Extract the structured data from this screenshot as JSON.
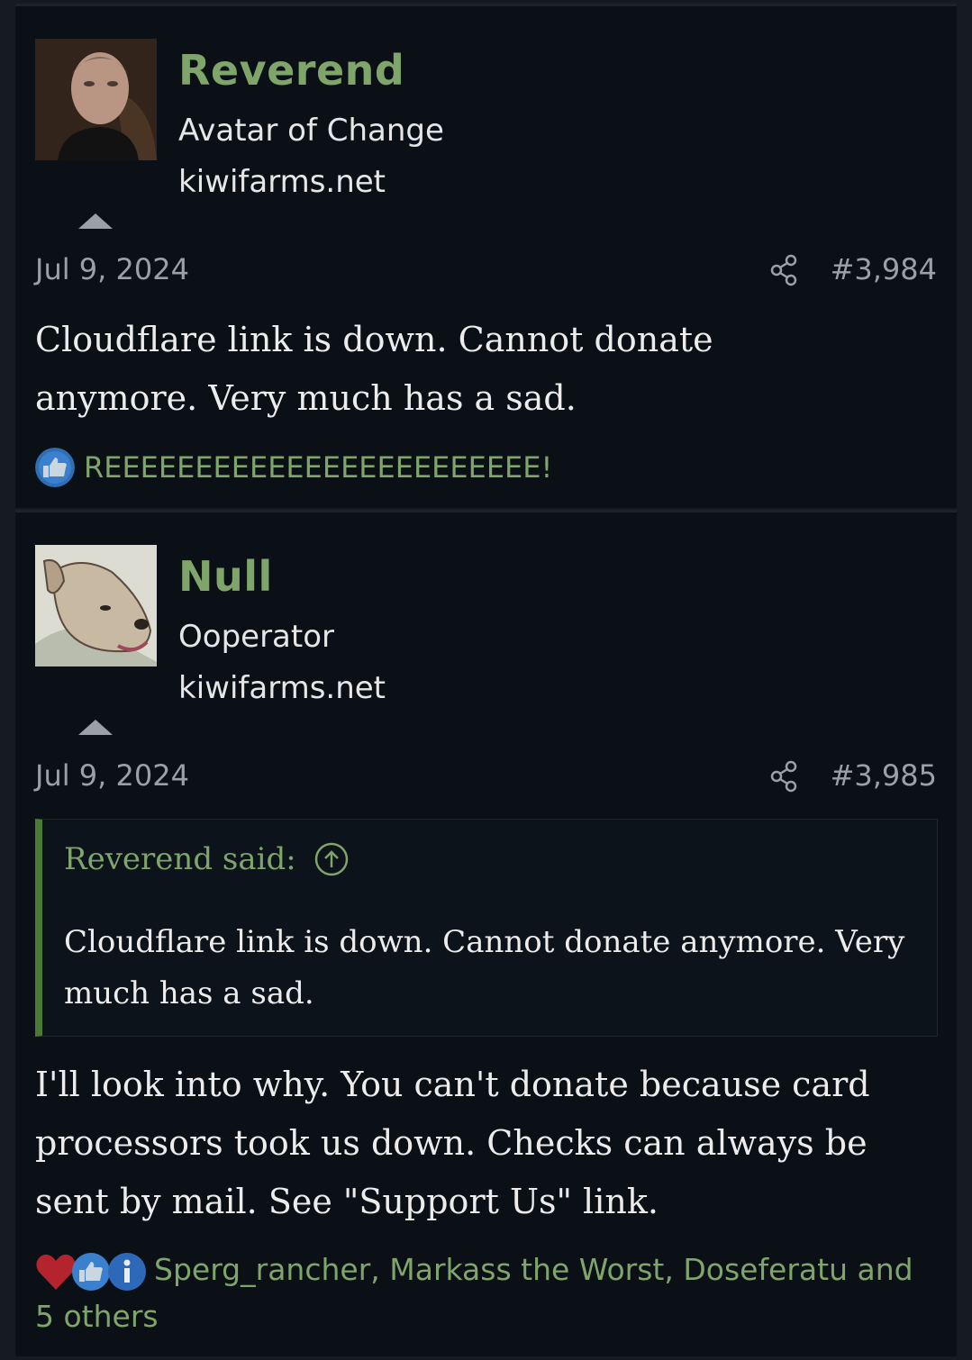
{
  "posts": [
    {
      "username": "Reverend",
      "user_title": "Avatar of Change",
      "user_host": "kiwifarms.net",
      "date": "Jul 9, 2024",
      "post_number": "#3,984",
      "body": "Cloudflare link is down. Cannot donate anymore. Very much has a sad.",
      "reaction_text": "REEEEEEEEEEEEEEEEEEEEEEEE!"
    },
    {
      "username": "Null",
      "user_title": "Ooperator",
      "user_host": "kiwifarms.net",
      "date": "Jul 9, 2024",
      "post_number": "#3,985",
      "quote": {
        "attribution": "Reverend said:",
        "text": "Cloudflare link is down. Cannot donate anymore. Very much has a sad."
      },
      "body": "I'll look into why. You can't donate because card processors took us down. Checks can always be sent by mail. See \"Support Us\" link.",
      "reactors_text": "Sperg_rancher, Markass the Worst, Doseferatu and 5 others"
    }
  ],
  "colors": {
    "accent_green": "#7fa56a",
    "post_bg": "#0b1017",
    "quote_border": "#4a7a34"
  },
  "icons": [
    "share-icon",
    "thumbs-up-icon",
    "heart-icon",
    "info-icon",
    "arrow-up-circle-icon"
  ]
}
